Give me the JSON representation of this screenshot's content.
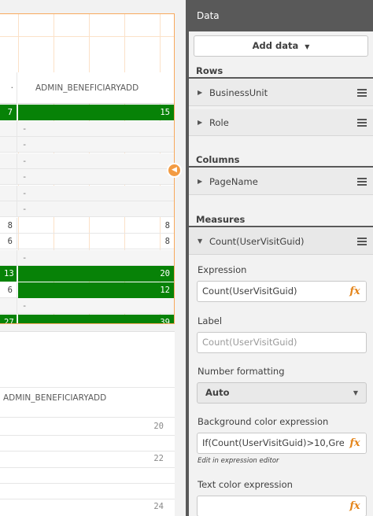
{
  "sheet": {
    "pivot1": {
      "header_right": "ADMIN_BENEFICIARYADD",
      "rows": [
        {
          "left": "7",
          "right": "15",
          "style": "green"
        },
        {
          "left": "",
          "right": "-",
          "style": "dash"
        },
        {
          "left": "",
          "right": "-",
          "style": "dash"
        },
        {
          "left": "",
          "right": "-",
          "style": "dash"
        },
        {
          "left": "",
          "right": "-",
          "style": "dash"
        },
        {
          "left": "",
          "right": "-",
          "style": "dash"
        },
        {
          "left": "",
          "right": "-",
          "style": "dash"
        },
        {
          "left": "8",
          "right": "8",
          "style": "plain"
        },
        {
          "left": "6",
          "right": "8",
          "style": "plain"
        },
        {
          "left": "",
          "right": "-",
          "style": "dash"
        },
        {
          "left": "13",
          "right": "20",
          "style": "green"
        },
        {
          "left": "6",
          "right": "12",
          "style": "greenright"
        },
        {
          "left": "",
          "right": "-",
          "style": "dash"
        },
        {
          "left": "27",
          "right": "39",
          "style": "green"
        }
      ]
    },
    "pivot2": {
      "header": "ADMIN_BENEFICIARYADD",
      "values": [
        "20",
        "22",
        "24"
      ]
    }
  },
  "panel": {
    "title": "Data",
    "add_data_label": "Add data",
    "sections": {
      "rows_title": "Rows",
      "rows_items": [
        "BusinessUnit",
        "Role"
      ],
      "columns_title": "Columns",
      "columns_items": [
        "PageName"
      ],
      "measures_title": "Measures",
      "measure_item": "Count(UserVisitGuid)"
    },
    "measure": {
      "expression_label": "Expression",
      "expression_value": "Count(UserVisitGuid)",
      "label_label": "Label",
      "label_placeholder": "Count(UserVisitGuid)",
      "number_formatting_label": "Number formatting",
      "number_formatting_value": "Auto",
      "bg_color_label": "Background color expression",
      "bg_color_value": "If(Count(UserVisitGuid)>10,Gre",
      "bg_color_hint": "Edit in expression editor",
      "text_color_label": "Text color expression",
      "fx_label": "fx"
    }
  },
  "colors": {
    "accent_orange": "#f39b42",
    "cell_green": "#078207",
    "panel_header": "#595959"
  }
}
